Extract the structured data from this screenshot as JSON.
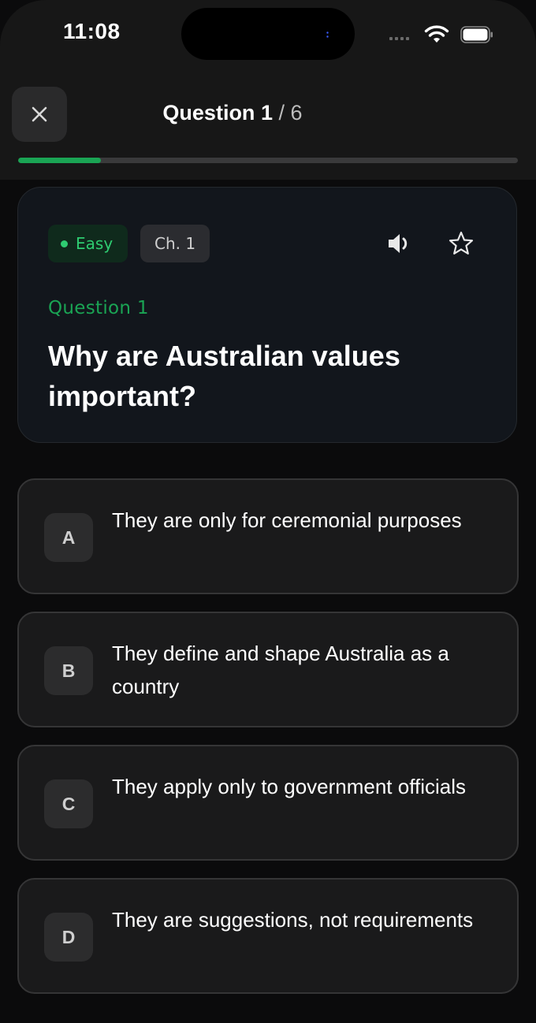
{
  "status_bar": {
    "time": "11:08"
  },
  "header": {
    "title": "Question",
    "current": "1",
    "separator": "/",
    "total": "6",
    "progress": 0.166
  },
  "question": {
    "difficulty": "Easy",
    "chapter": "Ch. 1",
    "label": "Question 1",
    "text": "Why are Australian values important?"
  },
  "options": [
    {
      "letter": "A",
      "text": "They are only for ceremonial purposes"
    },
    {
      "letter": "B",
      "text": "They define and shape Australia as a country"
    },
    {
      "letter": "C",
      "text": "They apply only to government officials"
    },
    {
      "letter": "D",
      "text": "They are suggestions, not requirements"
    }
  ],
  "colors": {
    "accent": "#1aa454",
    "easy_text": "#2ecc71",
    "background": "#0b0b0c",
    "card": "#12161c"
  },
  "icons": {
    "close": "close-icon",
    "speaker": "speaker-icon",
    "bookmark": "star-icon",
    "wifi": "wifi-icon",
    "battery": "battery-icon",
    "signal": "signal-icon"
  }
}
